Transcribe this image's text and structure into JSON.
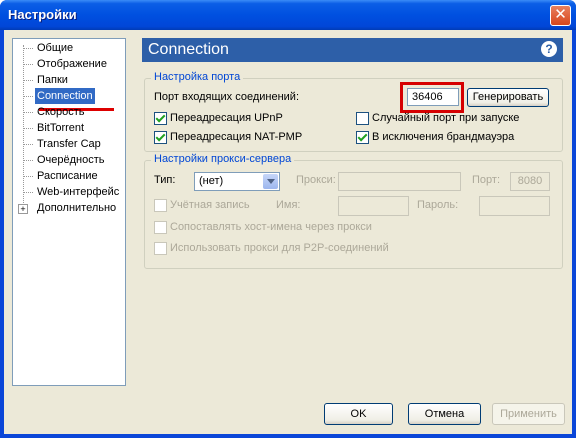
{
  "window": {
    "title": "Настройки",
    "close_glyph": "✕"
  },
  "sidebar": {
    "items": [
      {
        "label": "Общие"
      },
      {
        "label": "Отображение"
      },
      {
        "label": "Папки"
      },
      {
        "label": "Connection",
        "selected": true
      },
      {
        "label": "Скорость"
      },
      {
        "label": "BitTorrent"
      },
      {
        "label": "Transfer Cap"
      },
      {
        "label": "Очерёдность"
      },
      {
        "label": "Расписание"
      },
      {
        "label": "Web-интерфейс"
      },
      {
        "label": "Дополнительно",
        "expandable": true,
        "expand_glyph": "+"
      }
    ]
  },
  "panel": {
    "title": "Connection",
    "help_glyph": "?",
    "port_group": {
      "title": "Настройка порта",
      "port_label": "Порт входящих соединений:",
      "port_value": "36406",
      "generate_button": "Генерировать",
      "upnp": {
        "label": "Переадресация UPnP",
        "checked": true
      },
      "random_port": {
        "label": "Случайный порт при запуске",
        "checked": false
      },
      "natpmp": {
        "label": "Переадресация NAT-PMP",
        "checked": true
      },
      "firewall": {
        "label": "В исключения брандмауэра",
        "checked": true
      }
    },
    "proxy_group": {
      "title": "Настройки прокси-сервера",
      "type_label": "Тип:",
      "type_value": "(нет)",
      "proxy_label": "Прокси:",
      "proxy_value": "",
      "port_label": "Порт:",
      "port_value": "8080",
      "auth": {
        "label": "Учётная запись",
        "checked": false
      },
      "name_label": "Имя:",
      "password_label": "Пароль:",
      "resolve_hostnames": {
        "label": "Сопоставлять хост-имена через прокси",
        "checked": false
      },
      "p2p_proxy": {
        "label": "Использовать прокси для P2P-соединений",
        "checked": false
      }
    }
  },
  "footer": {
    "ok": "OK",
    "cancel": "Отмена",
    "apply": "Применить"
  },
  "colors": {
    "title_bar": "#0050e0",
    "header": "#2d5fa8",
    "selection": "#316ac5",
    "highlight_red": "#d60000"
  }
}
